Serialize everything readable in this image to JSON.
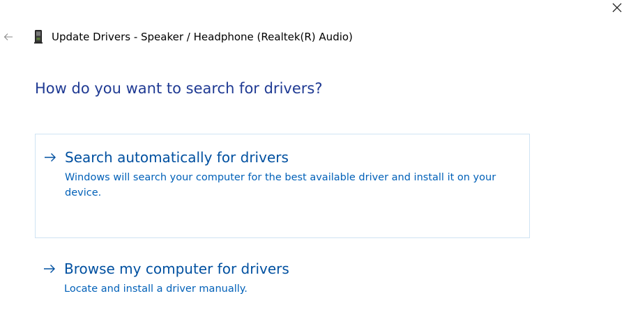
{
  "window": {
    "title": "Update Drivers - Speaker / Headphone (Realtek(R) Audio)"
  },
  "icons": {
    "close": "close-icon",
    "back": "back-arrow-icon",
    "device": "audio-device-icon",
    "option_arrow": "right-arrow-icon"
  },
  "main": {
    "heading": "How do you want to search for drivers?",
    "options": [
      {
        "title": "Search automatically for drivers",
        "description": "Windows will search your computer for the best available driver and install it on your device."
      },
      {
        "title": "Browse my computer for drivers",
        "description": "Locate and install a driver manually."
      }
    ]
  },
  "colors": {
    "heading": "#1f3a93",
    "link": "#0050a0",
    "link_desc": "#0060b8",
    "option_border": "#cfe3f3"
  }
}
